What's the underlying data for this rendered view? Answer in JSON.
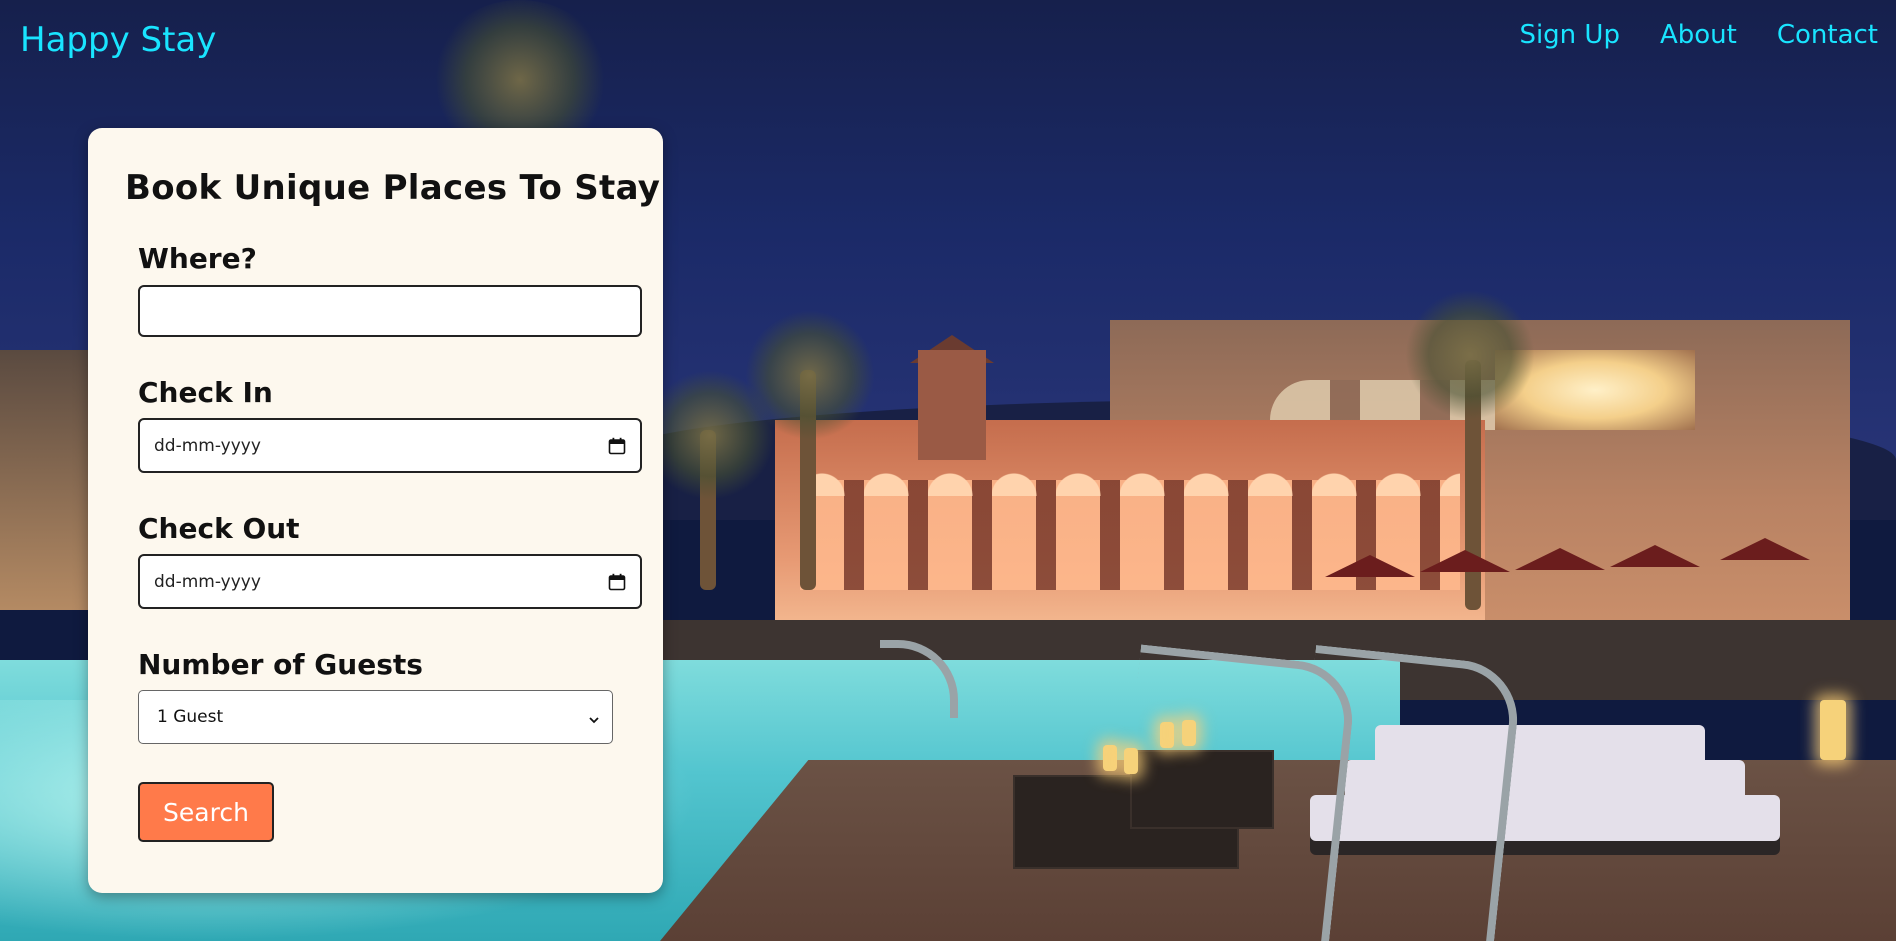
{
  "header": {
    "site_title": "Happy Stay",
    "nav": [
      {
        "label": "Sign Up"
      },
      {
        "label": "About"
      },
      {
        "label": "Contact"
      }
    ]
  },
  "booking_form": {
    "title": "Book Unique Places To Stay",
    "where": {
      "label": "Where?",
      "value": ""
    },
    "check_in": {
      "label": "Check In",
      "placeholder": "dd-mm-yyyy"
    },
    "check_out": {
      "label": "Check Out",
      "placeholder": "dd-mm-yyyy"
    },
    "guests": {
      "label": "Number of Guests",
      "selected": "1 Guest"
    },
    "search_label": "Search"
  },
  "colors": {
    "link": "#19e4ff",
    "card_background": "#fdf8ee",
    "button": "#ff7a4a"
  },
  "icons": [
    "calendar-icon",
    "chevron-down-icon"
  ]
}
